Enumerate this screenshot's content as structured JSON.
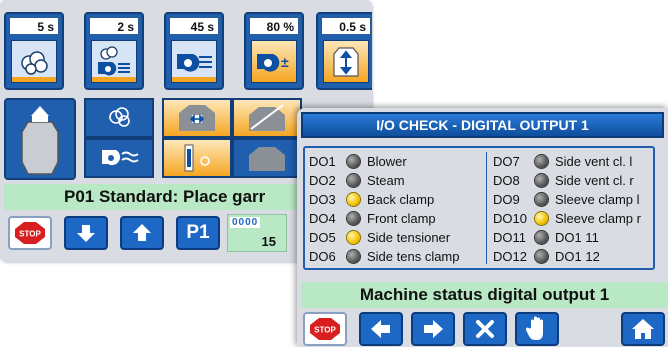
{
  "main_screen": {
    "tiles": [
      {
        "value": "5 s",
        "icon": "steam-cloud-icon"
      },
      {
        "value": "2 s",
        "icon": "blower-steam-icon"
      },
      {
        "value": "45 s",
        "icon": "blower-icon"
      },
      {
        "value": "80 %",
        "icon": "blower-adjust-icon"
      },
      {
        "value": "0.5 s",
        "icon": "garment-vertical-stretch-icon"
      }
    ],
    "status_text": "P01 Standard: Place garr",
    "program_label": "P1",
    "counter_top": "0000",
    "counter_value": "15"
  },
  "io_dialog": {
    "title": "I/O CHECK - DIGITAL OUTPUT 1",
    "left_outputs": [
      {
        "code": "DO1",
        "label": "Blower",
        "state": "off"
      },
      {
        "code": "DO2",
        "label": "Steam",
        "state": "off"
      },
      {
        "code": "DO3",
        "label": "Back clamp",
        "state": "on"
      },
      {
        "code": "DO4",
        "label": "Front clamp",
        "state": "off"
      },
      {
        "code": "DO5",
        "label": "Side tensioner",
        "state": "on"
      },
      {
        "code": "DO6",
        "label": "Side tens clamp",
        "state": "off"
      }
    ],
    "right_outputs": [
      {
        "code": "DO7",
        "label": "Side vent cl. l",
        "state": "off"
      },
      {
        "code": "DO8",
        "label": "Side vent cl. r",
        "state": "off"
      },
      {
        "code": "DO9",
        "label": "Sleeve clamp l",
        "state": "off"
      },
      {
        "code": "DO10",
        "label": "Sleeve clamp r",
        "state": "on"
      },
      {
        "code": "DO11",
        "label": "DO1 11",
        "state": "off"
      },
      {
        "code": "DO12",
        "label": "DO1 12",
        "state": "off"
      }
    ],
    "status_text": "Machine status digital output 1"
  },
  "colors": {
    "panel_blue": "#1f5fae",
    "accent_orange": "#f5a623",
    "status_green": "#b8e8c4",
    "led_on": "#f2c200",
    "led_off": "#4a4a4a",
    "stop_red": "#d81e1e"
  }
}
